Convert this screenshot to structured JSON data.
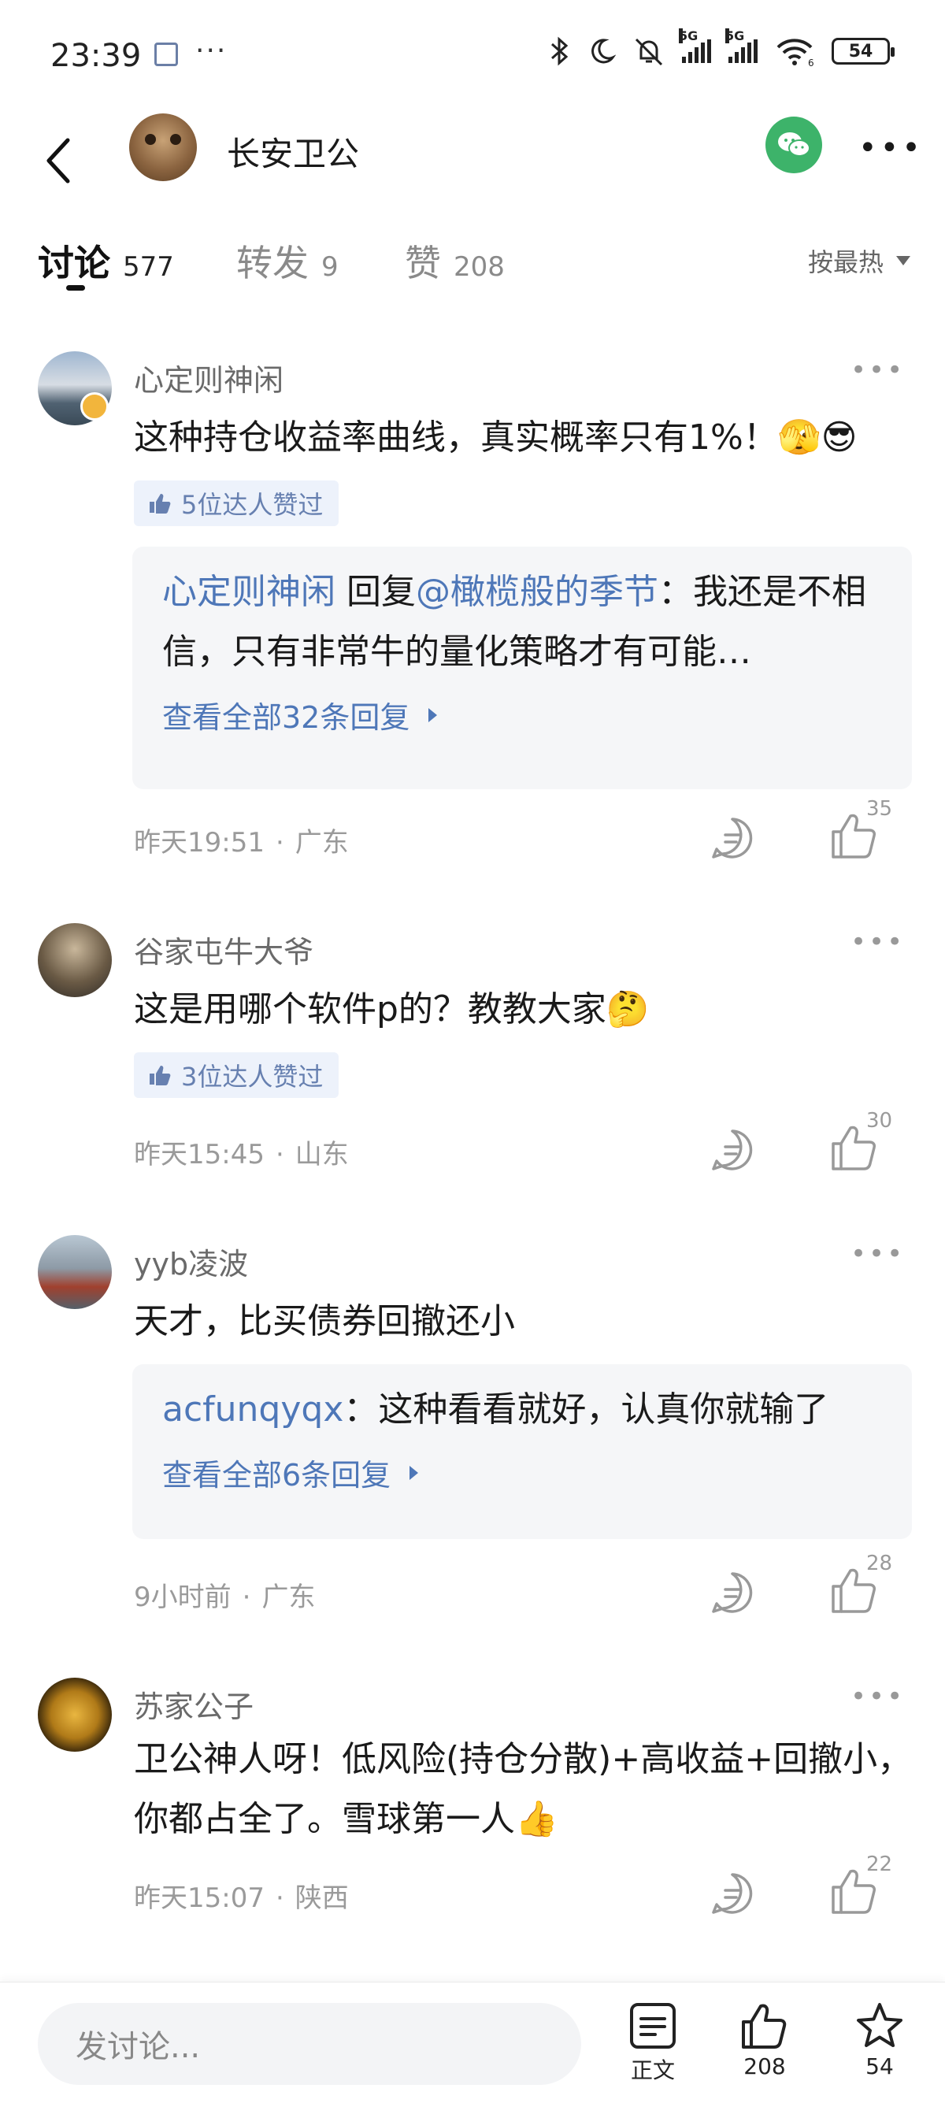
{
  "status_bar": {
    "time": "23:39",
    "dots": "···",
    "network_5g_1": "5G",
    "network_5g_2": "5G",
    "wifi_sub": "6",
    "battery": "54"
  },
  "header": {
    "title": "长安卫公"
  },
  "tabs": [
    {
      "label": "讨论",
      "count": "577",
      "active": true
    },
    {
      "label": "转发",
      "count": "9"
    },
    {
      "label": "赞",
      "count": "208"
    }
  ],
  "sort_label": "按最热",
  "comments": [
    {
      "name": "心定则神闲",
      "text": "这种持仓收益率曲线，真实概率只有1%！🫣😎",
      "badge": "5位达人赞过",
      "reply": {
        "author": "心定则神闲",
        "verb": " 回复",
        "mention": "@橄榄般的季节",
        "text": "：我还是不相信，只有非常牛的量化策略才有可能…",
        "more": "查看全部32条回复"
      },
      "time": "昨天19:51",
      "location": "广东",
      "likes": "35"
    },
    {
      "name": "谷家屯牛大爷",
      "text": "这是用哪个软件p的？教教大家🤔",
      "badge": "3位达人赞过",
      "time": "昨天15:45",
      "location": "山东",
      "likes": "30"
    },
    {
      "name": "yyb凌波",
      "text": "天才，比买债券回撤还小",
      "reply": {
        "author": "acfunqyqx",
        "text": "：这种看看就好，认真你就输了",
        "more": "查看全部6条回复"
      },
      "time": "9小时前",
      "location": "广东",
      "likes": "28"
    },
    {
      "name": "苏家公子",
      "text": "卫公神人呀！低风险(持仓分散)+高收益+回撤小，你都占全了。雪球第一人👍",
      "time": "昨天15:07",
      "location": "陕西",
      "likes": "22"
    }
  ],
  "bottom_bar": {
    "input_placeholder": "发讨论...",
    "article_label": "正文",
    "like_count": "208",
    "favorite_count": "54"
  },
  "colors": {
    "link_blue": "#4e77b8",
    "badge_bg": "#edf2fb",
    "wechat_green": "#3db36a",
    "reply_bg": "#f5f6f8"
  }
}
